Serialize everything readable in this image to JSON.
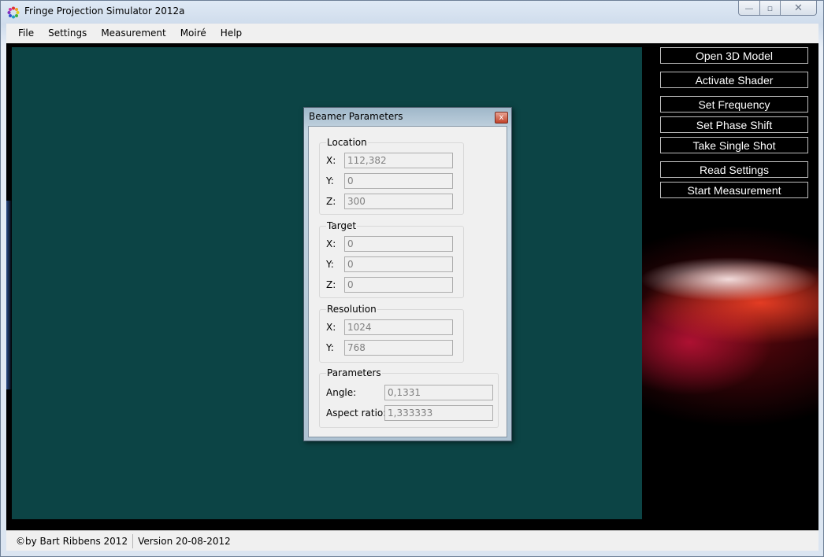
{
  "window": {
    "title": "Fringe Projection Simulator 2012a",
    "caption": {
      "minimize": "—",
      "maximize": "▫",
      "close": "✕"
    }
  },
  "menu": [
    "File",
    "Settings",
    "Measurement",
    "Moiré",
    "Help"
  ],
  "side_buttons": [
    "Open 3D Model",
    "Activate Shader",
    "Set Frequency",
    "Set Phase Shift",
    "Take Single Shot",
    "Read Settings",
    "Start Measurement"
  ],
  "dialog": {
    "title": "Beamer Parameters",
    "close": "x",
    "location": {
      "title": "Location",
      "x_label": "X:",
      "y_label": "Y:",
      "z_label": "Z:",
      "x": "112,382",
      "y": "0",
      "z": "300"
    },
    "target": {
      "title": "Target",
      "x_label": "X:",
      "y_label": "Y:",
      "z_label": "Z:",
      "x": "0",
      "y": "0",
      "z": "0"
    },
    "resolution": {
      "title": "Resolution",
      "x_label": "X:",
      "y_label": "Y:",
      "x": "1024",
      "y": "768"
    },
    "parameters": {
      "title": "Parameters",
      "angle_label": "Angle:",
      "aspect_label": "Aspect ratio:",
      "angle": "0,1331",
      "aspect": "1,333333"
    }
  },
  "status": {
    "copyright": "©by Bart Ribbens 2012",
    "version": "Version 20-08-2012"
  },
  "colors": {
    "viewport": "#0c4445",
    "panel_bg": "#000000",
    "accent_red": "#e02020"
  }
}
